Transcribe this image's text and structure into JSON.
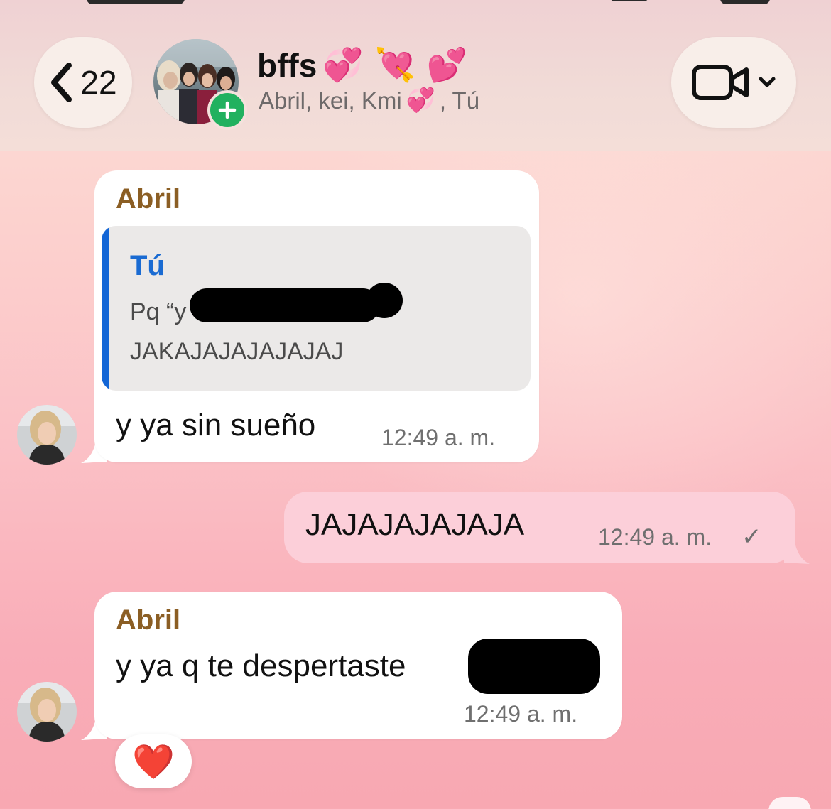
{
  "header": {
    "back_count": "22",
    "group_name": "bffs",
    "group_emojis": [
      "💞",
      "💘",
      "💕"
    ],
    "members_text": "Abril, kei, Kmi",
    "members_emoji": "💞",
    "members_suffix": ", Tú"
  },
  "messages": [
    {
      "sender": "Abril",
      "quote": {
        "author": "Tú",
        "line1": "Pq “y",
        "line2": "JAKAJAJAJAJAJAJ"
      },
      "text": "y ya sin sueño",
      "time": "12:49 a. m."
    },
    {
      "outgoing": true,
      "text": "JAJAJAJAJAJA",
      "time": "12:49 a. m.",
      "status": "✓"
    },
    {
      "sender": "Abril",
      "text": "y ya q te despertaste",
      "time": "12:49 a. m.",
      "reaction": "❤️"
    }
  ],
  "colors": {
    "sender_name": "#8b5e24",
    "quote_author": "#1a6bd2",
    "quote_bar": "#1366d6",
    "outgoing_bubble": "#fccfd9",
    "add_badge": "#21b15f"
  },
  "icons": {
    "back": "chevron-left-icon",
    "video": "video-camera-icon",
    "dropdown": "chevron-down-icon",
    "add": "plus-icon",
    "read": "checkmark-icon"
  }
}
